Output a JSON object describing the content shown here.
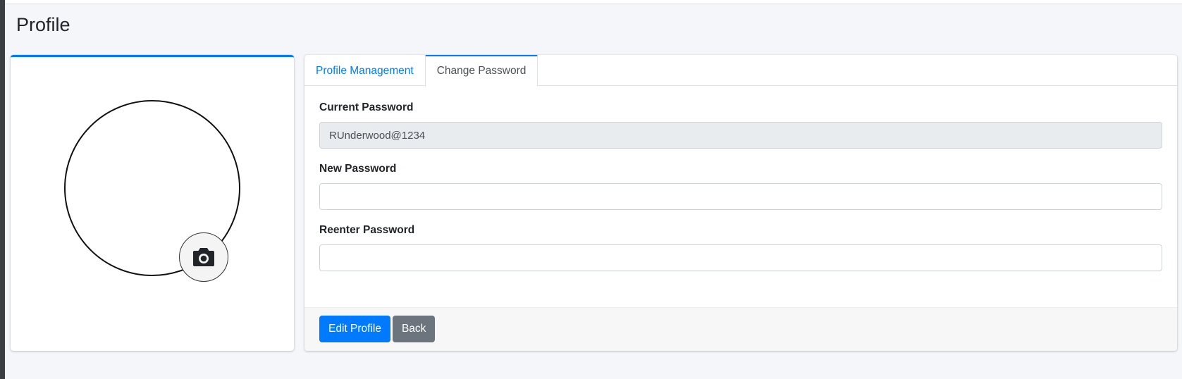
{
  "page": {
    "title": "Profile"
  },
  "tabs": [
    {
      "label": "Profile Management",
      "active": false
    },
    {
      "label": "Change Password",
      "active": true
    }
  ],
  "form": {
    "current_password": {
      "label": "Current Password",
      "value": "RUnderwood@1234"
    },
    "new_password": {
      "label": "New Password",
      "value": ""
    },
    "reenter_password": {
      "label": "Reenter Password",
      "value": ""
    }
  },
  "buttons": {
    "edit_profile": "Edit Profile",
    "back": "Back"
  },
  "avatar": {
    "upload_icon": "camera-icon"
  },
  "colors": {
    "accent": "#007bff",
    "secondary": "#6c757d",
    "background": "#f4f6f9"
  }
}
